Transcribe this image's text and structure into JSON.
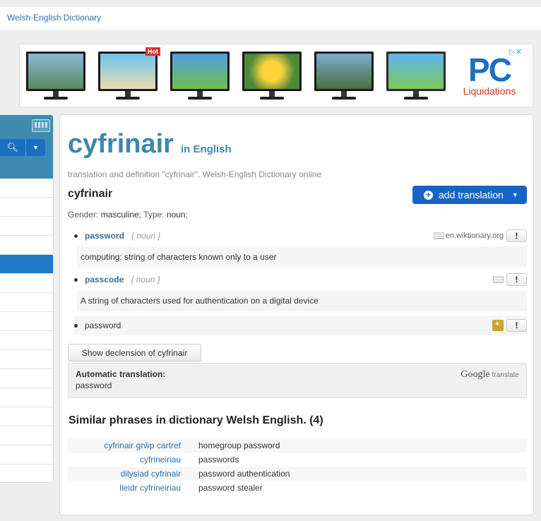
{
  "header": {
    "site_link": "Welsh-English Dictionary"
  },
  "ads": {
    "hot_badge": "Hot",
    "brand_big": "PC",
    "brand_small": "Liquidations",
    "marks": "▷✕",
    "screens": [
      "#6aa2c9",
      "#55b3e8",
      "#4fa0e0",
      "#ffd23a",
      "#6a8e4a",
      "#5fb4f0"
    ]
  },
  "main": {
    "title_word": "cyfrinair",
    "title_lang": "in English",
    "subtitle": "translation and definition \"cyfrinair\", Welsh-English Dictionary  online",
    "headword": "cyfrinair",
    "add_translation": "add translation",
    "gender_label": "Gender:",
    "gender_value": "masculine",
    "type_label": "; Type:",
    "type_value": "noun",
    "type_end": ";",
    "translations": [
      {
        "word": "password",
        "pos": "{ noun }",
        "source": "en.wiktionary.org",
        "definition": "computing: string of characters known only to a user"
      },
      {
        "word": "passcode",
        "pos": "{ noun }",
        "source": "",
        "definition": "A string of characters used for authentication on a digital device"
      },
      {
        "word": "password",
        "pos": "",
        "source": "",
        "definition": ""
      }
    ],
    "exclaim": "!",
    "declension_button": "Show declension of cyfrinair",
    "auto_label": "Automatic translation:",
    "auto_value": "password",
    "google": "Google",
    "google_translate": "translate",
    "similar_heading": "Similar phrases in dictionary Welsh English. (4)",
    "similar": [
      {
        "welsh": "cyfrinair grŵp cartref",
        "english": "homegroup password"
      },
      {
        "welsh": "cyfrineiriau",
        "english": "passwords"
      },
      {
        "welsh": "dilysiad cyfrinair",
        "english": "password authentication"
      },
      {
        "welsh": "lleidr cyfrineiriau",
        "english": "password stealer"
      }
    ]
  },
  "colors": {
    "accent": "#3e87ad",
    "button": "#1565c8",
    "link": "#2a6fa8"
  }
}
